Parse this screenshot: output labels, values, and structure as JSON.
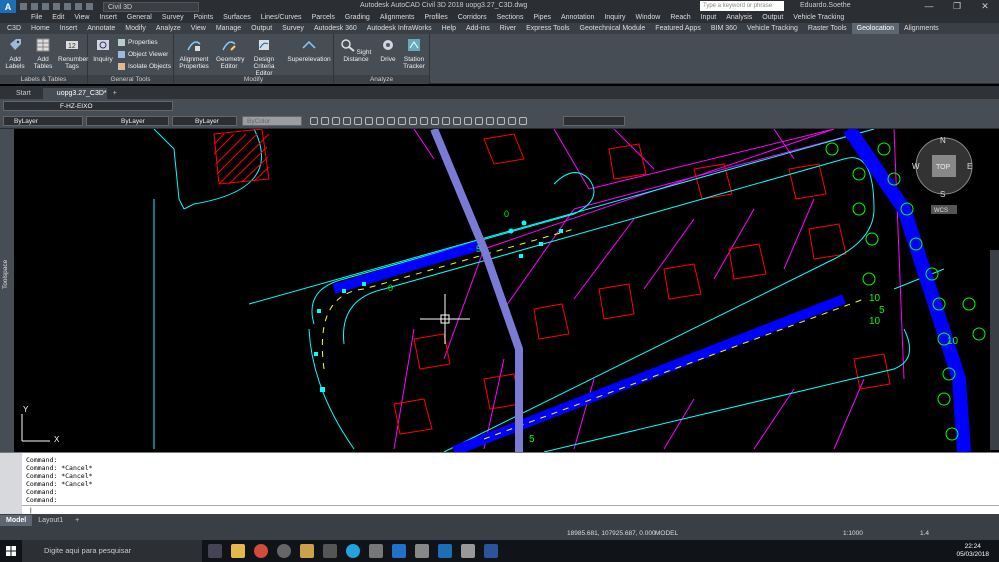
{
  "titlebar": {
    "app_initial": "A",
    "workspace": "Civil 3D",
    "title": "Autodesk AutoCAD Civil 3D 2018   uopg3.27_C3D.dwg",
    "search_placeholder": "Type a keyword or phrase",
    "user": "Eduardo.Soethe",
    "minimize": "—",
    "maximize": "❐",
    "close": "✕"
  },
  "menus": [
    "File",
    "Edit",
    "View",
    "Insert",
    "General",
    "Survey",
    "Points",
    "Surfaces",
    "Lines/Curves",
    "Parcels",
    "Grading",
    "Alignments",
    "Profiles",
    "Corridors",
    "Sections",
    "Pipes",
    "Annotation",
    "Inquiry",
    "Window",
    "Reach",
    "Input",
    "Analysis",
    "Output",
    "Vehicle Tracking"
  ],
  "ribbon_tabs": [
    {
      "label": "C3D",
      "active": false
    },
    {
      "label": "Home",
      "active": false
    },
    {
      "label": "Insert",
      "active": false
    },
    {
      "label": "Annotate",
      "active": false
    },
    {
      "label": "Modify",
      "active": false
    },
    {
      "label": "Analyze",
      "active": false
    },
    {
      "label": "View",
      "active": false
    },
    {
      "label": "Manage",
      "active": false
    },
    {
      "label": "Output",
      "active": false
    },
    {
      "label": "Survey",
      "active": false
    },
    {
      "label": "Autodesk 360",
      "active": false
    },
    {
      "label": "Autodesk InfraWorks",
      "active": false
    },
    {
      "label": "Help",
      "active": false
    },
    {
      "label": "Add-ins",
      "active": false
    },
    {
      "label": "River",
      "active": false
    },
    {
      "label": "Express Tools",
      "active": false
    },
    {
      "label": "Geotechnical Module",
      "active": false
    },
    {
      "label": "Featured Apps",
      "active": false
    },
    {
      "label": "BIM 360",
      "active": false
    },
    {
      "label": "Vehicle Tracking",
      "active": false
    },
    {
      "label": "Raster Tools",
      "active": false
    },
    {
      "label": "Geolocation",
      "active": true
    },
    {
      "label": "Alignments",
      "active": false
    }
  ],
  "ribbon": {
    "labels_panel": "Labels & Tables",
    "add_labels": "Add Labels",
    "add_tables": "Add Tables",
    "renumber_tags": "Renumber Tags",
    "general_panel": "General Tools",
    "inquiry": "Inquiry",
    "properties": "Properties",
    "object_viewer": "Object Viewer",
    "isolate_objects": "Isolate Objects",
    "modify_panel": "Modify",
    "alignment_properties": "Alignment Properties",
    "geometry_editor": "Geometry Editor",
    "design_criteria_editor": "Design Criteria Editor",
    "superelevation": "Superelevation",
    "analyze_panel": "Analyze",
    "sight_distance": "Sight Distance",
    "drive": "Drive",
    "station_tracker": "Station Tracker"
  },
  "doc_tabs": {
    "start": "Start",
    "file": "uopg3.27_C3D*",
    "plus": "+"
  },
  "layer": {
    "current": "F-HZ-EIXO"
  },
  "properties": {
    "color": "ByLayer",
    "linetype": "ByLayer",
    "lineweight": "ByLayer",
    "plotstyle": "ByColor"
  },
  "toolspace_label": "Toolspace",
  "viewcube": {
    "top": "TOP",
    "n": "N",
    "s": "S",
    "e": "E",
    "w": "W",
    "wcs": "WCS"
  },
  "ucs": {
    "x": "X",
    "y": "Y"
  },
  "drawing_labels": {
    "label_a": "10",
    "label_b": "5",
    "label_c": "10",
    "label_d": "5",
    "label_e": "0",
    "label_f": "5",
    "label_g": "0",
    "label_h": "10",
    "label_i": "5"
  },
  "command_history": [
    "Command:",
    "Command: *Cancel*",
    "Command: *Cancel*",
    "Command: *Cancel*",
    "Command:",
    "Command:"
  ],
  "command_prompt": "|",
  "layout_tabs": [
    {
      "label": "Model",
      "active": true
    },
    {
      "label": "Layout1",
      "active": false
    },
    {
      "label": "+",
      "active": false
    }
  ],
  "status": {
    "coords": "18985.681, 107925.687, 0.000",
    "space": "MODEL",
    "scale": "1:1000",
    "number": "1.4"
  },
  "taskbar": {
    "search": "Digite aqui para pesquisar",
    "time": "22:24",
    "date": "05/03/2018"
  },
  "colors": {
    "road_fill": "#0000ff",
    "parcel_lines": "#ff00ff",
    "buildings": "#ff0000",
    "alignment": "#00ffff",
    "tree": "#00ff00",
    "utility": "#7b7bd6"
  }
}
